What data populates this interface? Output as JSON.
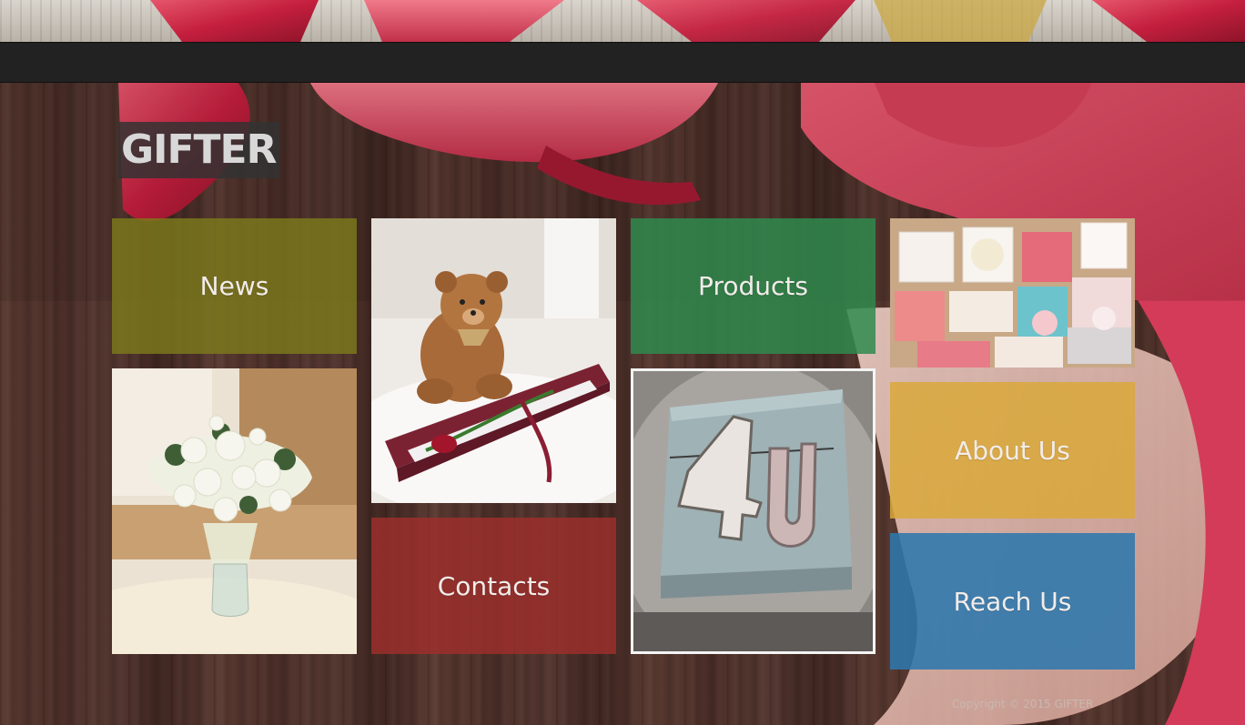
{
  "brand": {
    "logo_text": "GIFTER"
  },
  "tiles": {
    "news": {
      "label": "News",
      "color": "#7d7a1c"
    },
    "products": {
      "label": "Products",
      "color": "#2f8a4e"
    },
    "contacts": {
      "label": "Contacts",
      "color": "#9b2f2c"
    },
    "about": {
      "label": "About Us",
      "color": "#d9a83a"
    },
    "reach": {
      "label": "Reach Us",
      "color": "#2d78ad"
    }
  },
  "photos": {
    "bouquet": {
      "icon": "flower-bouquet-photo"
    },
    "teddy": {
      "icon": "teddy-bear-rose-box-photo"
    },
    "gift_4u": {
      "icon": "4u-gift-box-photo"
    },
    "gift_boxes": {
      "icon": "decorated-gift-boxes-photo"
    }
  },
  "footer": {
    "copyright": "Copyright © 2015 GIFTER"
  }
}
